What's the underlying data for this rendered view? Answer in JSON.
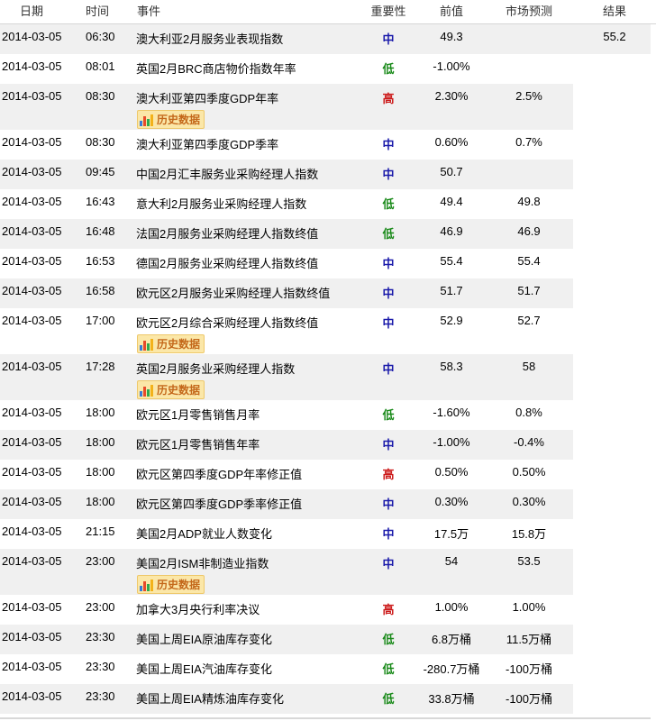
{
  "header": {
    "date": "日期",
    "time": "时间",
    "event": "事件",
    "importance": "重要性",
    "previous": "前值",
    "forecast": "市场预测",
    "result": "结果"
  },
  "history_label": "历史数据",
  "importance_labels": {
    "low": "低",
    "mid": "中",
    "high": "高"
  },
  "colors": {
    "low": "#1a8a1a",
    "mid": "#1a1aaa",
    "high": "#cc1a1a",
    "row_alt": "#f0f0f0"
  },
  "rows": [
    {
      "date": "2014-03-05",
      "time": "06:30",
      "event": "澳大利亚2月服务业表现指数",
      "importance": "mid",
      "previous": "49.3",
      "forecast": "",
      "result": "55.2",
      "history": false
    },
    {
      "date": "2014-03-05",
      "time": "08:01",
      "event": "英国2月BRC商店物价指数年率",
      "importance": "low",
      "previous": "-1.00%",
      "forecast": "",
      "result": "",
      "history": false
    },
    {
      "date": "2014-03-05",
      "time": "08:30",
      "event": "澳大利亚第四季度GDP年率",
      "importance": "high",
      "previous": "2.30%",
      "forecast": "2.5%",
      "result": "",
      "history": true
    },
    {
      "date": "2014-03-05",
      "time": "08:30",
      "event": "澳大利亚第四季度GDP季率",
      "importance": "mid",
      "previous": "0.60%",
      "forecast": "0.7%",
      "result": "",
      "history": false
    },
    {
      "date": "2014-03-05",
      "time": "09:45",
      "event": "中国2月汇丰服务业采购经理人指数",
      "importance": "mid",
      "previous": "50.7",
      "forecast": "",
      "result": "",
      "history": false
    },
    {
      "date": "2014-03-05",
      "time": "16:43",
      "event": "意大利2月服务业采购经理人指数",
      "importance": "low",
      "previous": "49.4",
      "forecast": "49.8",
      "result": "",
      "history": false
    },
    {
      "date": "2014-03-05",
      "time": "16:48",
      "event": "法国2月服务业采购经理人指数终值",
      "importance": "low",
      "previous": "46.9",
      "forecast": "46.9",
      "result": "",
      "history": false
    },
    {
      "date": "2014-03-05",
      "time": "16:53",
      "event": "德国2月服务业采购经理人指数终值",
      "importance": "mid",
      "previous": "55.4",
      "forecast": "55.4",
      "result": "",
      "history": false
    },
    {
      "date": "2014-03-05",
      "time": "16:58",
      "event": "欧元区2月服务业采购经理人指数终值",
      "importance": "mid",
      "previous": "51.7",
      "forecast": "51.7",
      "result": "",
      "history": false
    },
    {
      "date": "2014-03-05",
      "time": "17:00",
      "event": "欧元区2月综合采购经理人指数终值",
      "importance": "mid",
      "previous": "52.9",
      "forecast": "52.7",
      "result": "",
      "history": true
    },
    {
      "date": "2014-03-05",
      "time": "17:28",
      "event": "英国2月服务业采购经理人指数",
      "importance": "mid",
      "previous": "58.3",
      "forecast": "58",
      "result": "",
      "history": true
    },
    {
      "date": "2014-03-05",
      "time": "18:00",
      "event": "欧元区1月零售销售月率",
      "importance": "low",
      "previous": "-1.60%",
      "forecast": "0.8%",
      "result": "",
      "history": false
    },
    {
      "date": "2014-03-05",
      "time": "18:00",
      "event": "欧元区1月零售销售年率",
      "importance": "mid",
      "previous": "-1.00%",
      "forecast": "-0.4%",
      "result": "",
      "history": false
    },
    {
      "date": "2014-03-05",
      "time": "18:00",
      "event": "欧元区第四季度GDP年率修正值",
      "importance": "high",
      "previous": "0.50%",
      "forecast": "0.50%",
      "result": "",
      "history": false
    },
    {
      "date": "2014-03-05",
      "time": "18:00",
      "event": "欧元区第四季度GDP季率修正值",
      "importance": "mid",
      "previous": "0.30%",
      "forecast": "0.30%",
      "result": "",
      "history": false
    },
    {
      "date": "2014-03-05",
      "time": "21:15",
      "event": "美国2月ADP就业人数变化",
      "importance": "mid",
      "previous": "17.5万",
      "forecast": "15.8万",
      "result": "",
      "history": false
    },
    {
      "date": "2014-03-05",
      "time": "23:00",
      "event": "美国2月ISM非制造业指数",
      "importance": "mid",
      "previous": "54",
      "forecast": "53.5",
      "result": "",
      "history": true
    },
    {
      "date": "2014-03-05",
      "time": "23:00",
      "event": "加拿大3月央行利率决议",
      "importance": "high",
      "previous": "1.00%",
      "forecast": "1.00%",
      "result": "",
      "history": false
    },
    {
      "date": "2014-03-05",
      "time": "23:30",
      "event": "美国上周EIA原油库存变化",
      "importance": "low",
      "previous": "6.8万桶",
      "forecast": "11.5万桶",
      "result": "",
      "history": false
    },
    {
      "date": "2014-03-05",
      "time": "23:30",
      "event": "美国上周EIA汽油库存变化",
      "importance": "low",
      "previous": "-280.7万桶",
      "forecast": "-100万桶",
      "result": "",
      "history": false
    },
    {
      "date": "2014-03-05",
      "time": "23:30",
      "event": "美国上周EIA精炼油库存变化",
      "importance": "low",
      "previous": "33.8万桶",
      "forecast": "-100万桶",
      "result": "",
      "history": false
    }
  ]
}
